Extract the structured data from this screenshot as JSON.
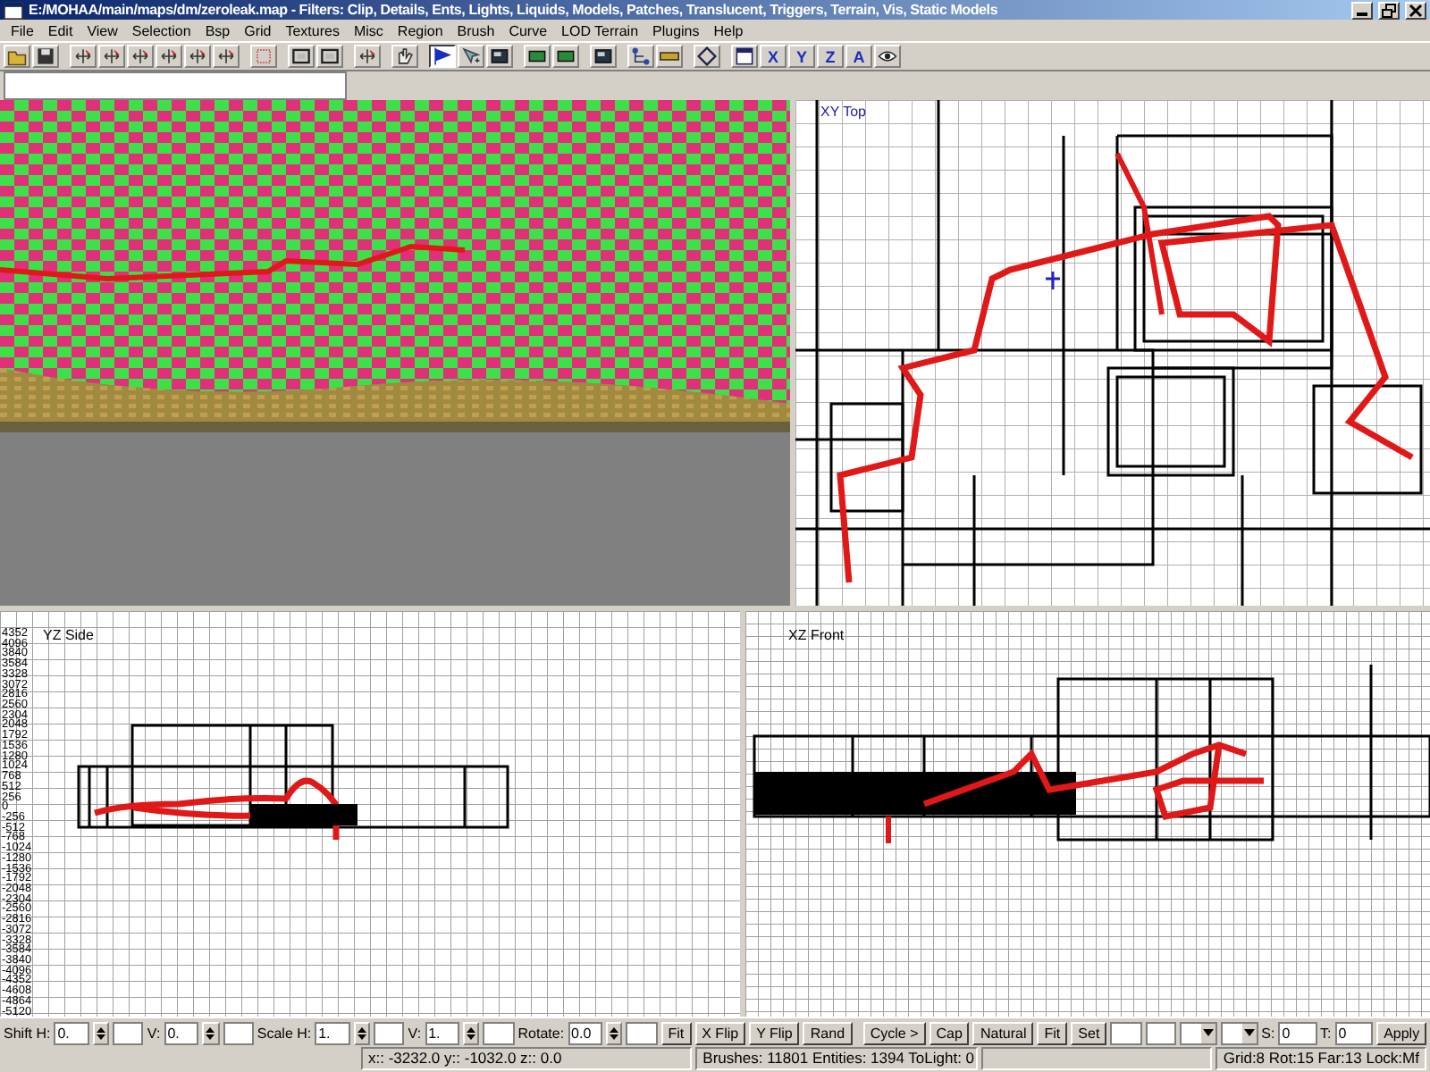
{
  "window": {
    "title": "E:/MOHAA/main/maps/dm/zeroleak.map - Filters: Clip, Details, Ents, Lights, Liquids, Models, Patches, Translucent, Triggers, Terrain, Vis, Static Models"
  },
  "menu": [
    "File",
    "Edit",
    "View",
    "Selection",
    "Bsp",
    "Grid",
    "Textures",
    "Misc",
    "Region",
    "Brush",
    "Curve",
    "LOD Terrain",
    "Plugins",
    "Help"
  ],
  "toolbar": [
    {
      "kind": "folder",
      "pressed": false
    },
    {
      "kind": "disk",
      "pressed": false
    },
    {
      "kind": "sep"
    },
    {
      "kind": "arrows",
      "pressed": false
    },
    {
      "kind": "arrows",
      "pressed": false
    },
    {
      "kind": "arrows",
      "pressed": false
    },
    {
      "kind": "arrows",
      "pressed": false
    },
    {
      "kind": "arrows",
      "pressed": false
    },
    {
      "kind": "arrows",
      "pressed": false
    },
    {
      "kind": "sep"
    },
    {
      "kind": "dots",
      "pressed": false
    },
    {
      "kind": "sep"
    },
    {
      "kind": "frame",
      "pressed": false
    },
    {
      "kind": "frame",
      "pressed": false
    },
    {
      "kind": "sep"
    },
    {
      "kind": "arrows",
      "pressed": false
    },
    {
      "kind": "sep"
    },
    {
      "kind": "hand",
      "pressed": false
    },
    {
      "kind": "sep"
    },
    {
      "kind": "flag",
      "pressed": true
    },
    {
      "kind": "pointer",
      "pressed": false
    },
    {
      "kind": "screen",
      "pressed": false
    },
    {
      "kind": "sep"
    },
    {
      "kind": "block",
      "pressed": false
    },
    {
      "kind": "block",
      "pressed": false
    },
    {
      "kind": "sep"
    },
    {
      "kind": "screen",
      "pressed": false
    },
    {
      "kind": "sep"
    },
    {
      "kind": "nodes",
      "pressed": false
    },
    {
      "kind": "ruler",
      "pressed": false
    },
    {
      "kind": "sep"
    },
    {
      "kind": "diamond",
      "pressed": false
    },
    {
      "kind": "sep"
    },
    {
      "kind": "window",
      "pressed": false
    },
    {
      "kind": "letter",
      "label": "X",
      "pressed": false
    },
    {
      "kind": "letter",
      "label": "Y",
      "pressed": false
    },
    {
      "kind": "letter",
      "label": "Z",
      "pressed": false
    },
    {
      "kind": "letter",
      "label": "A",
      "pressed": false
    },
    {
      "kind": "eye",
      "pressed": false
    }
  ],
  "views": {
    "top_label": "XY Top",
    "side_label": "YZ Side",
    "front_label": "XZ Front",
    "side_ticks": [
      "4352",
      "4096",
      "3840",
      "3584",
      "3328",
      "3072",
      "2816",
      "2560",
      "2304",
      "2048",
      "1792",
      "1536",
      "1280",
      "1024",
      "768",
      "512",
      "256",
      "0",
      "-256",
      "-512",
      "-768",
      "-1024",
      "-1280",
      "-1536",
      "-1792",
      "-2048",
      "-2304",
      "-2560",
      "-2816",
      "-3072",
      "-3328",
      "-3584",
      "-3840",
      "-4096",
      "-4352",
      "-4608",
      "-4864",
      "-5120"
    ]
  },
  "surface_bar": {
    "spin_fields": [
      {
        "label": "Shift H:",
        "value": "0."
      },
      {
        "label": "V:",
        "value": "0."
      },
      {
        "label": "Scale H:",
        "value": "1."
      },
      {
        "label": "V:",
        "value": "1."
      },
      {
        "label": "Rotate:",
        "value": "0.0"
      }
    ],
    "buttons_1": [
      "Fit",
      "X Flip",
      "Y Flip",
      "Rand"
    ],
    "buttons_2": [
      "Cycle >",
      "Cap",
      "Natural",
      "Fit",
      "Set"
    ],
    "st_fields": [
      {
        "label": "S:",
        "value": "0"
      },
      {
        "label": "T:",
        "value": "0"
      }
    ],
    "apply": "Apply"
  },
  "status_bar": {
    "coords": "x:: -3232.0  y:: -1032.0  z:: 0.0",
    "counts": "Brushes: 11801 Entities: 1394 ToLight: 0",
    "grid": "Grid:8 Rot:15 Far:13 Lock:Mf"
  }
}
